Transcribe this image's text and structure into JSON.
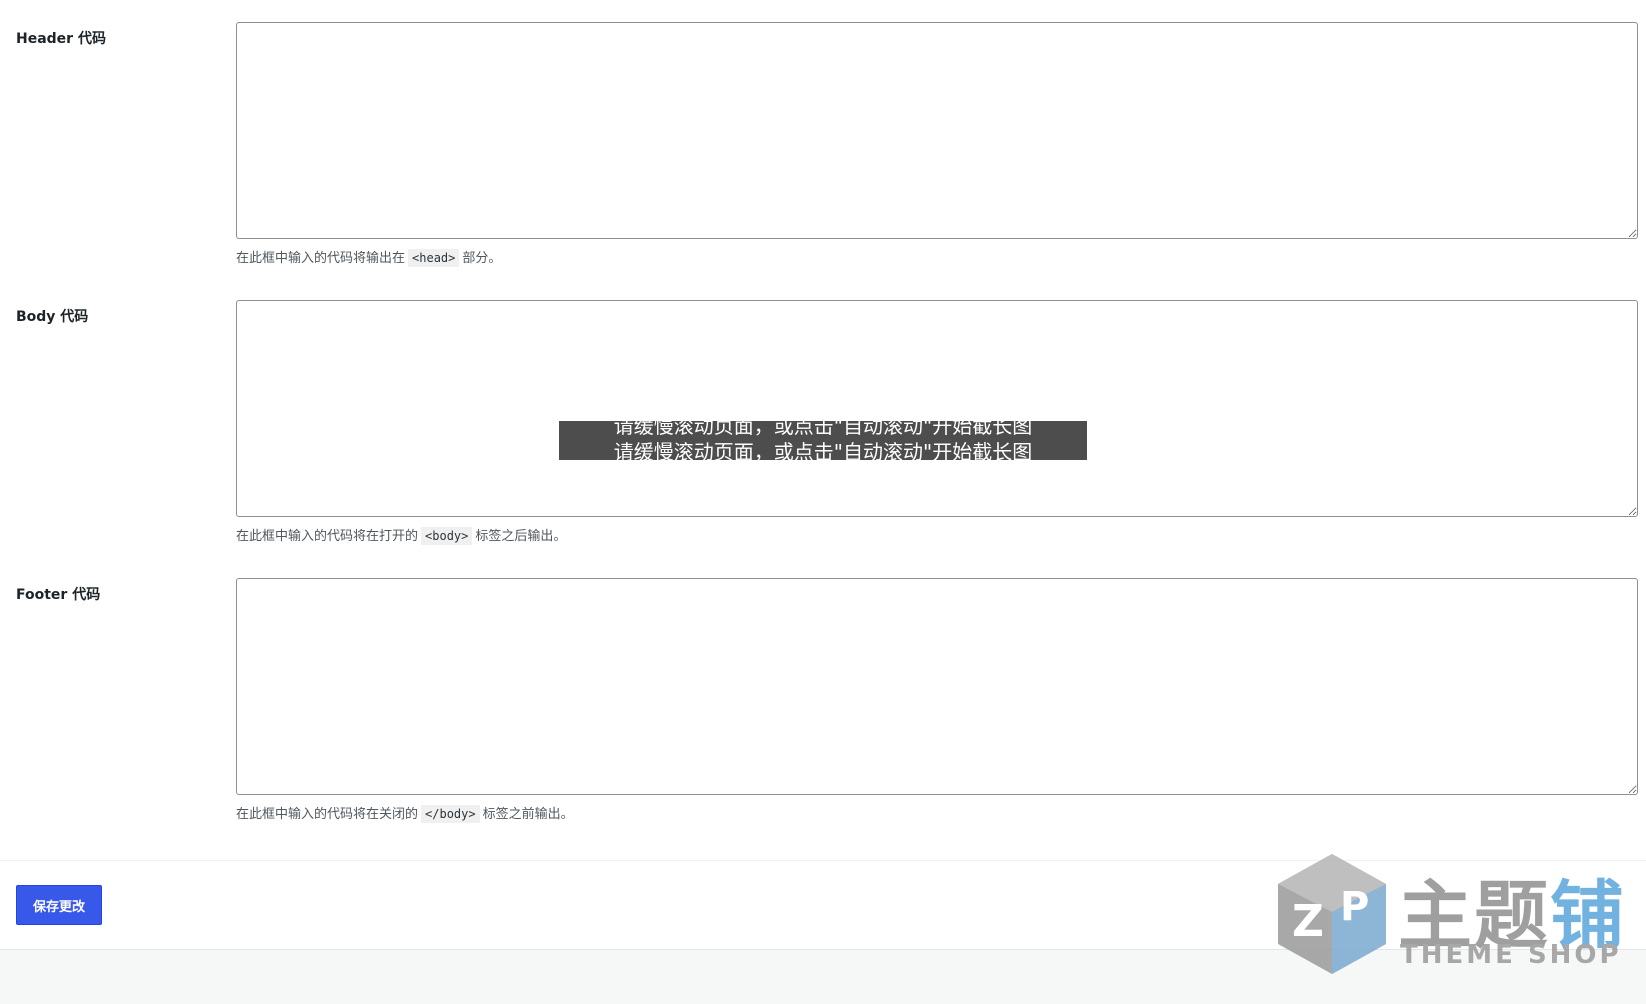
{
  "fields": [
    {
      "label": "Header 代码",
      "value": "",
      "help_before": "在此框中输入的代码将输出在",
      "help_code": "<head>",
      "help_after": "部分。"
    },
    {
      "label": "Body 代码",
      "value": "",
      "help_before": "在此框中输入的代码将在打开的",
      "help_code": "<body>",
      "help_after": "标签之后输出。"
    },
    {
      "label": "Footer 代码",
      "value": "",
      "help_before": "在此框中输入的代码将在关闭的",
      "help_code": "</body>",
      "help_after": "标签之前输出。"
    }
  ],
  "actions": {
    "save_label": "保存更改"
  },
  "overlay": {
    "message": "请缓慢滚动页面，或点击\"自动滚动\"开始截长图"
  },
  "watermark": {
    "brand_part1": "主题",
    "brand_part2": "铺",
    "subtitle": "THEME SHOP"
  },
  "colors": {
    "primary_button": "#3858e9",
    "help_text": "#50575e",
    "textarea_border": "#8c8f94",
    "watermark_gray": "#8f8f8f",
    "watermark_blue": "#5aa5dc"
  }
}
